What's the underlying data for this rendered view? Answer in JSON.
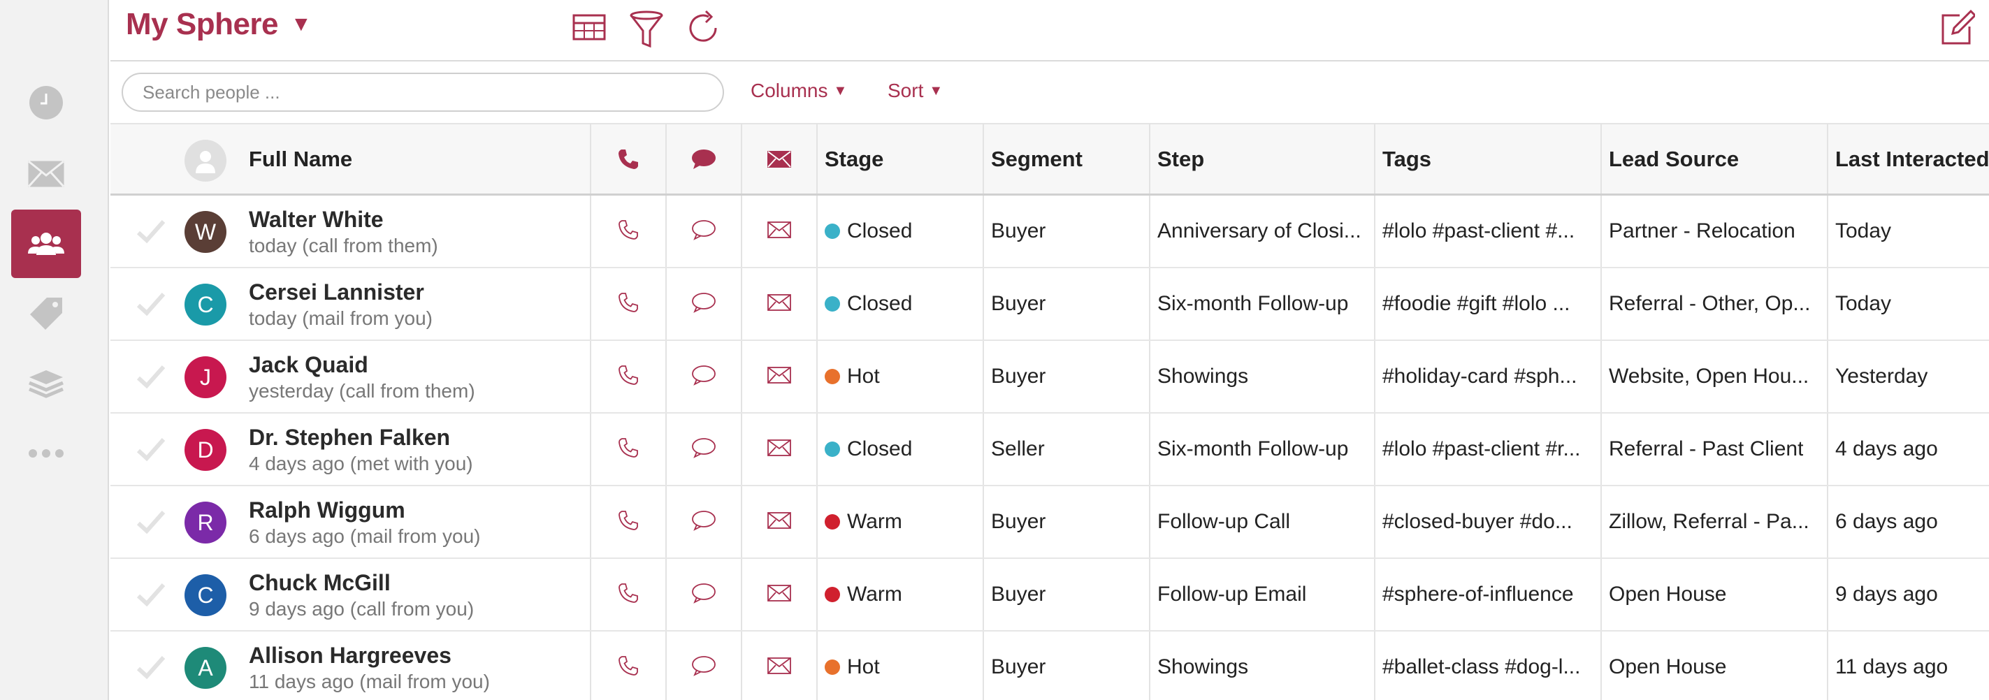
{
  "sidebar": {
    "items": [
      {
        "icon": "clock-icon",
        "active": false
      },
      {
        "icon": "envelope-icon",
        "active": false
      },
      {
        "icon": "people-icon",
        "active": true
      },
      {
        "icon": "tag-icon",
        "active": false
      },
      {
        "icon": "layers-icon",
        "active": false
      },
      {
        "icon": "more-icon",
        "active": false
      }
    ]
  },
  "header": {
    "title": "My Sphere",
    "title_caret": "▼",
    "tools": [
      "table-view-icon",
      "filter-icon",
      "refresh-icon"
    ],
    "compose_icon": "compose-icon"
  },
  "search": {
    "placeholder": "Search people ...",
    "value": ""
  },
  "controls": {
    "columns_label": "Columns",
    "sort_label": "Sort",
    "caret": "▼"
  },
  "colors": {
    "accent": "#a8304f",
    "stage_closed": "#3ab1c8",
    "stage_hot": "#e8712c",
    "stage_warm": "#d0202e"
  },
  "table": {
    "headers": {
      "name": "Full Name",
      "stage": "Stage",
      "segment": "Segment",
      "step": "Step",
      "tags": "Tags",
      "lead_source": "Lead Source",
      "last_interacted": "Last Interacted"
    },
    "rows": [
      {
        "initial": "W",
        "avatar_color": "#5a3e36",
        "name": "Walter White",
        "sub": "today (call from them)",
        "stage": "Closed",
        "stage_color": "#3ab1c8",
        "segment": "Buyer",
        "step": "Anniversary of Closi...",
        "tags": "#lolo #past-client #...",
        "lead_source": "Partner - Relocation",
        "last": "Today"
      },
      {
        "initial": "C",
        "avatar_color": "#1a9aa8",
        "name": "Cersei Lannister",
        "sub": "today (mail from you)",
        "stage": "Closed",
        "stage_color": "#3ab1c8",
        "segment": "Buyer",
        "step": "Six-month Follow-up",
        "tags": "#foodie #gift #lolo ...",
        "lead_source": "Referral - Other, Op...",
        "last": "Today"
      },
      {
        "initial": "J",
        "avatar_color": "#c8184f",
        "name": "Jack Quaid",
        "sub": "yesterday (call from them)",
        "stage": "Hot",
        "stage_color": "#e8712c",
        "segment": "Buyer",
        "step": "Showings",
        "tags": "#holiday-card #sph...",
        "lead_source": "Website, Open Hou...",
        "last": "Yesterday"
      },
      {
        "initial": "D",
        "avatar_color": "#c8184f",
        "name": "Dr. Stephen Falken",
        "sub": "4 days ago (met with you)",
        "stage": "Closed",
        "stage_color": "#3ab1c8",
        "segment": "Seller",
        "step": "Six-month Follow-up",
        "tags": "#lolo #past-client #r...",
        "lead_source": "Referral - Past Client",
        "last": "4 days ago"
      },
      {
        "initial": "R",
        "avatar_color": "#7b2aa8",
        "name": "Ralph Wiggum",
        "sub": "6 days ago (mail from you)",
        "stage": "Warm",
        "stage_color": "#d0202e",
        "segment": "Buyer",
        "step": "Follow-up Call",
        "tags": "#closed-buyer #do...",
        "lead_source": "Zillow, Referral - Pa...",
        "last": "6 days ago"
      },
      {
        "initial": "C",
        "avatar_color": "#1d5ea8",
        "name": "Chuck McGill",
        "sub": "9 days ago (call from you)",
        "stage": "Warm",
        "stage_color": "#d0202e",
        "segment": "Buyer",
        "step": "Follow-up Email",
        "tags": "#sphere-of-influence",
        "lead_source": "Open House",
        "last": "9 days ago"
      },
      {
        "initial": "A",
        "avatar_color": "#1e8a78",
        "name": "Allison Hargreeves",
        "sub": "11 days ago (mail from you)",
        "stage": "Hot",
        "stage_color": "#e8712c",
        "segment": "Buyer",
        "step": "Showings",
        "tags": "#ballet-class #dog-l...",
        "lead_source": "Open House",
        "last": "11 days ago"
      }
    ]
  }
}
